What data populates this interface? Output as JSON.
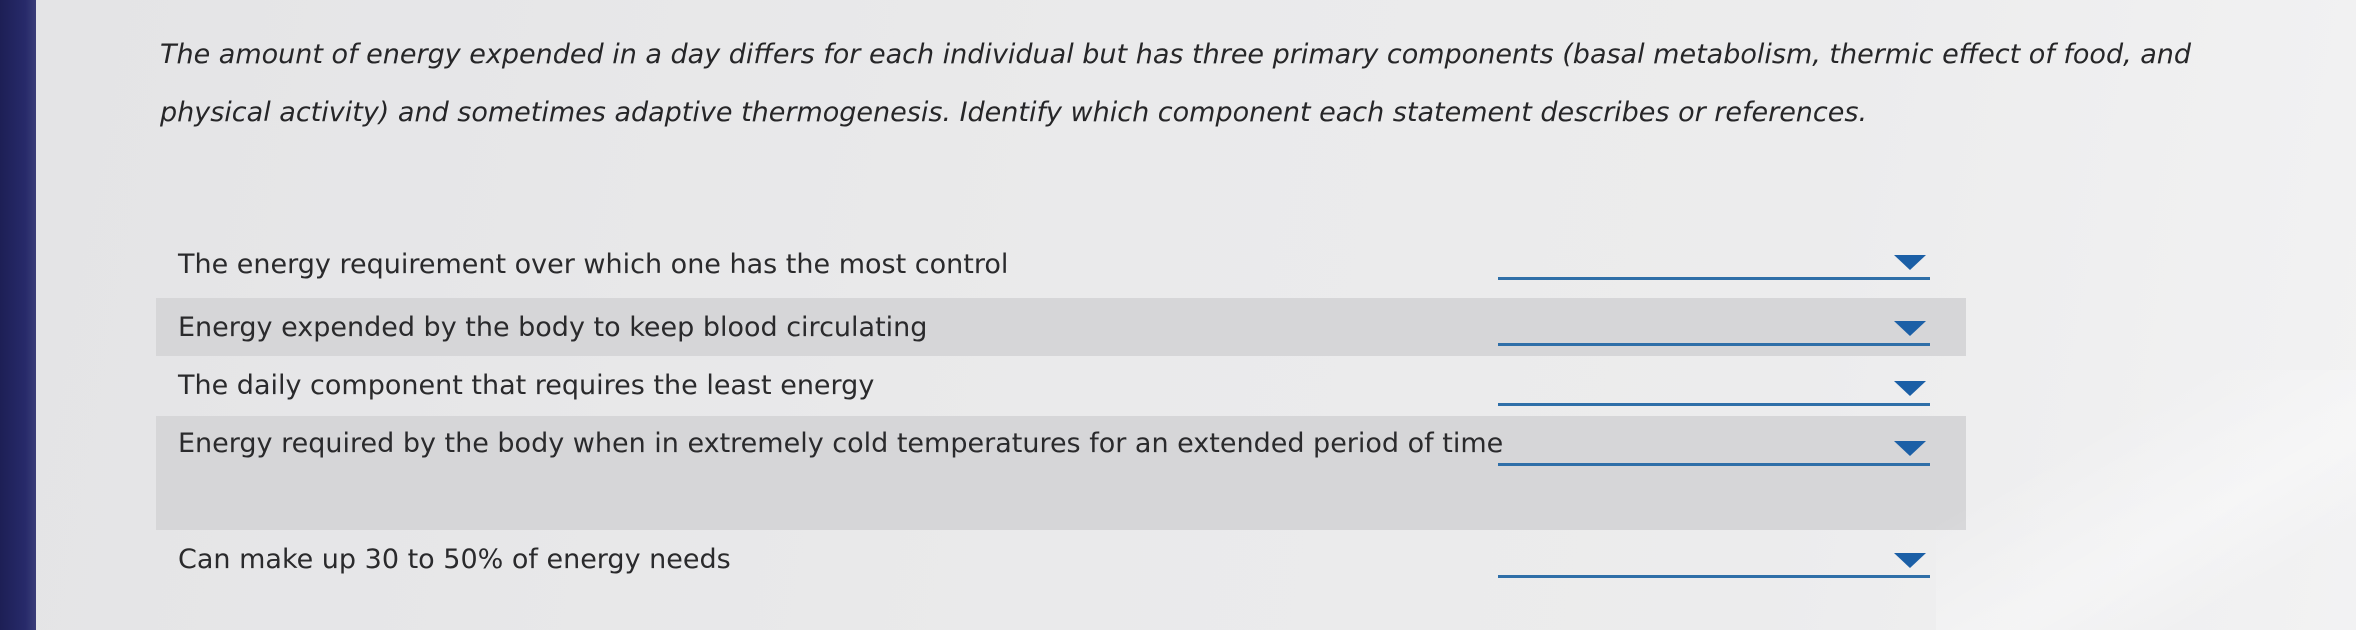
{
  "instructions": {
    "line1": "The amount of energy expended in a day differs for each individual but has three primary components (basal metabolism, thermic effect of food, and",
    "line2": "physical activity) and sometimes adaptive thermogenesis. Identify which component each statement describes or references."
  },
  "questions": [
    {
      "text": "The energy requirement over which one has the most control",
      "selected": ""
    },
    {
      "text": "Energy expended by the body to keep blood circulating",
      "selected": ""
    },
    {
      "text": "The daily component that requires the least energy",
      "selected": ""
    },
    {
      "text": "Energy required by the body when in extremely cold temperatures for an extended period of time",
      "selected": ""
    },
    {
      "text": "Can make up 30 to 50% of energy needs",
      "selected": ""
    }
  ],
  "icons": {
    "dropdown": "caret-down-icon"
  },
  "colors": {
    "dropdown_line": "#2f6fa8",
    "dropdown_caret": "#1b5fa6",
    "shaded_row": "#d6d6d8"
  }
}
